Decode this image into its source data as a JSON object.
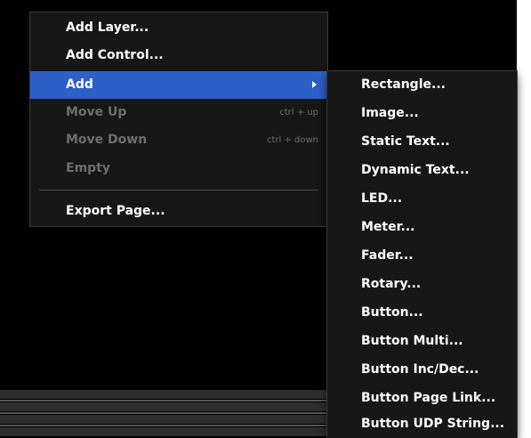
{
  "context_menu": {
    "items": [
      {
        "label": "Add Layer..."
      },
      {
        "label": "Add Control..."
      },
      {
        "label": "Add"
      },
      {
        "label": "Move Up",
        "shortcut": "ctrl + up"
      },
      {
        "label": "Move Down",
        "shortcut": "ctrl + down"
      },
      {
        "label": "Empty"
      },
      {
        "label": "Export Page..."
      }
    ],
    "highlighted_item": "Add",
    "highlight_color": "#2d5fc9",
    "disabled_items": [
      "Move Up",
      "Move Down",
      "Empty"
    ]
  },
  "add_submenu": {
    "items": [
      {
        "label": "Rectangle..."
      },
      {
        "label": "Image..."
      },
      {
        "label": "Static Text..."
      },
      {
        "label": "Dynamic Text..."
      },
      {
        "label": "LED..."
      },
      {
        "label": "Meter..."
      },
      {
        "label": "Fader..."
      },
      {
        "label": "Rotary..."
      },
      {
        "label": "Button..."
      },
      {
        "label": "Button Multi..."
      },
      {
        "label": "Button Inc/Dec..."
      },
      {
        "label": "Button Page Link..."
      },
      {
        "label": "Button UDP String..."
      }
    ]
  },
  "icons": {
    "submenu_arrow": "chevron-right-icon"
  }
}
